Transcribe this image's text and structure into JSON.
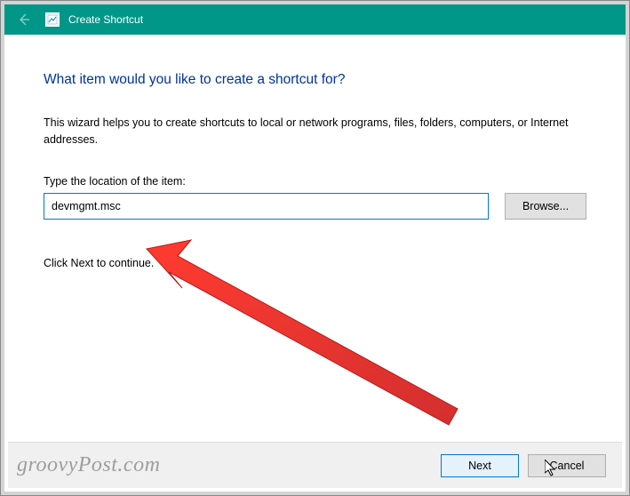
{
  "titlebar": {
    "title": "Create Shortcut"
  },
  "main": {
    "heading": "What item would you like to create a shortcut for?",
    "description": "This wizard helps you to create shortcuts to local or network programs, files, folders, computers, or Internet addresses.",
    "field_label": "Type the location of the item:",
    "location_value": "devmgmt.msc",
    "browse_label": "Browse...",
    "continue_text": "Click Next to continue."
  },
  "footer": {
    "watermark": "groovyPost.com",
    "next_label": "Next",
    "cancel_label": "Cancel"
  }
}
